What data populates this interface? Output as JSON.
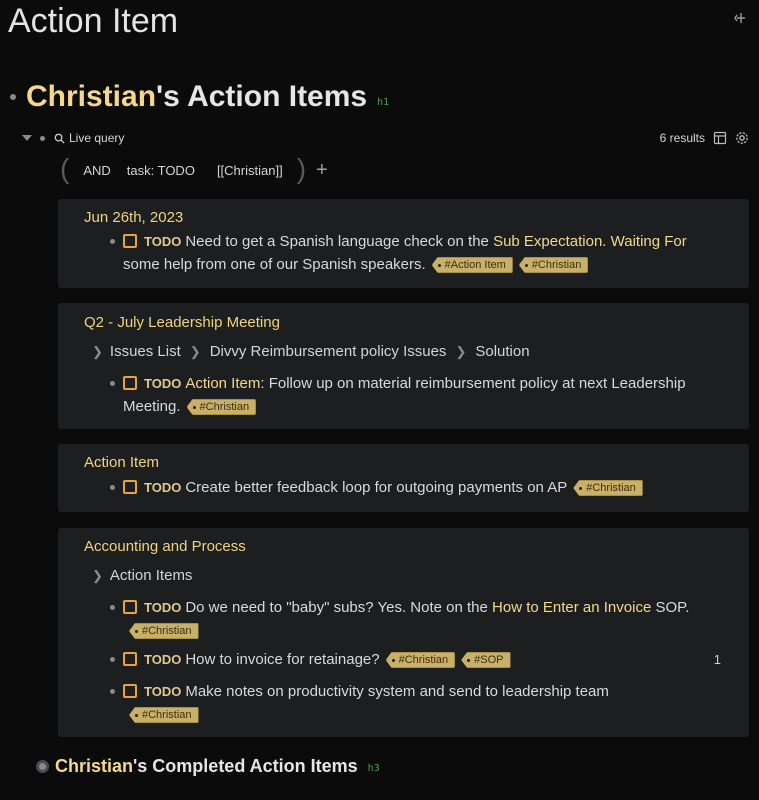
{
  "page": {
    "title": "Action Item"
  },
  "heading1": {
    "ref": "Christian",
    "text": "'s Action Items",
    "tag": "h1"
  },
  "query": {
    "label": "Live query",
    "results": "6 results",
    "filters": [
      "AND",
      "task: TODO",
      "[[Christian]]"
    ],
    "add": "+"
  },
  "cards": [
    {
      "title": "Jun 26th, 2023",
      "tasks": [
        {
          "marker": "TODO",
          "pre": "Need to get a Spanish language check on the ",
          "link": "Sub Expectation. Waiting For",
          "post": " some help from one of our Spanish speakers.",
          "tags": [
            "#Action Item",
            "#Christian"
          ]
        }
      ]
    },
    {
      "title": "Q2 - July Leadership Meeting",
      "breadcrumb": [
        "Issues List",
        "Divvy Reimbursement policy Issues",
        "Solution"
      ],
      "tasks": [
        {
          "marker": "TODO",
          "link": "Action Item",
          "post": ": Follow up on material reimbursement policy at next Leadership Meeting.",
          "tags": [
            "#Christian"
          ]
        }
      ]
    },
    {
      "title": "Action Item",
      "tasks": [
        {
          "marker": "TODO",
          "pre": "Create better feedback loop for outgoing payments on AP",
          "tags": [
            "#Christian"
          ]
        }
      ]
    },
    {
      "title": "Accounting and Process",
      "breadcrumb": [
        "Action Items"
      ],
      "tasks": [
        {
          "marker": "TODO",
          "pre": "Do we need to \"baby\" subs? Yes. Note on the ",
          "link": "How to Enter an Invoice",
          "post": " SOP.",
          "tags": [
            "#Christian"
          ]
        },
        {
          "marker": "TODO",
          "pre": "How to invoice for retainage?",
          "tags": [
            "#Christian",
            "#SOP"
          ],
          "ref_count": "1"
        },
        {
          "marker": "TODO",
          "pre": "Make notes on productivity system and send to leadership team",
          "tags": [
            "#Christian"
          ]
        }
      ]
    }
  ],
  "heading3": {
    "ref": "Christian",
    "text": "'s Completed Action Items",
    "tag": "h3"
  },
  "colors": {
    "accent": "#f4d98a",
    "checkbox": "#e8a33d",
    "tag_bg": "#c9b068",
    "card_bg": "#1d1e20"
  }
}
